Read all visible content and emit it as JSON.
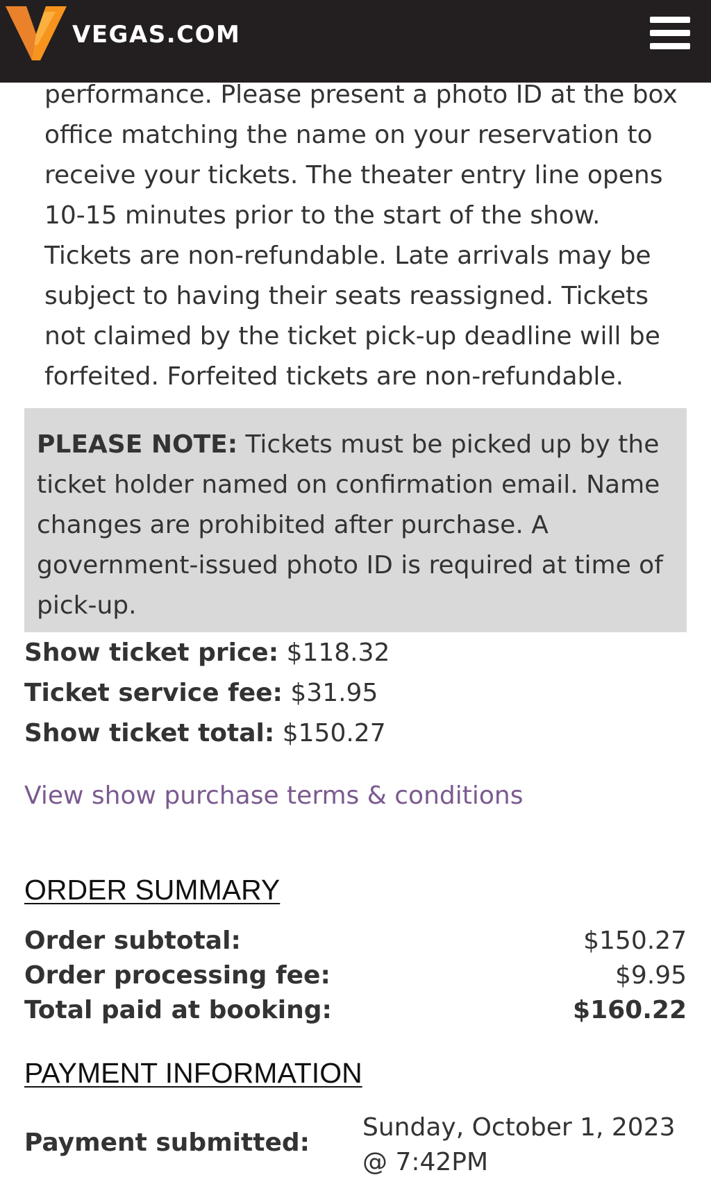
{
  "header": {
    "logo_text": "VEGAS.COM",
    "menu_icon": "hamburger-menu-icon"
  },
  "policy": {
    "text": "performance. Please present a photo ID at the box office matching the name on your reservation to receive your tickets. The theater entry line opens 10-15 minutes prior to the start of the show. Tickets are non-refundable. Late arrivals may be subject to having their seats reassigned. Tickets not claimed by the ticket pick-up deadline will be forfeited. Forfeited tickets are non-refundable."
  },
  "note": {
    "label": "PLEASE NOTE:",
    "text": " Tickets must be picked up by the ticket holder named on confirmation email. Name changes are prohibited after purchase. A government-issued photo ID is required at time of pick-up."
  },
  "fees": [
    {
      "label": "Show ticket price:",
      "value": " $118.32"
    },
    {
      "label": "Ticket service fee:",
      "value": " $31.95"
    },
    {
      "label": "Show ticket total:",
      "value": " $150.27"
    }
  ],
  "terms_link": "View show purchase terms & conditions",
  "order_summary": {
    "title": "ORDER SUMMARY",
    "rows": [
      {
        "label": "Order subtotal:",
        "value": "$150.27"
      },
      {
        "label": "Order processing fee:",
        "value": "$9.95"
      },
      {
        "label": "Total paid at booking:",
        "value": "$160.22"
      }
    ]
  },
  "payment": {
    "title": "PAYMENT INFORMATION",
    "label": "Payment submitted:",
    "date_line1": "Sunday, October 1, 2023",
    "date_line2": "@ 7:42PM"
  },
  "colors": {
    "header_bg": "#231f20",
    "logo_orange": "#f7941d",
    "link": "#7b5a8f",
    "note_bg": "#d9d9d9",
    "text": "#333333"
  }
}
